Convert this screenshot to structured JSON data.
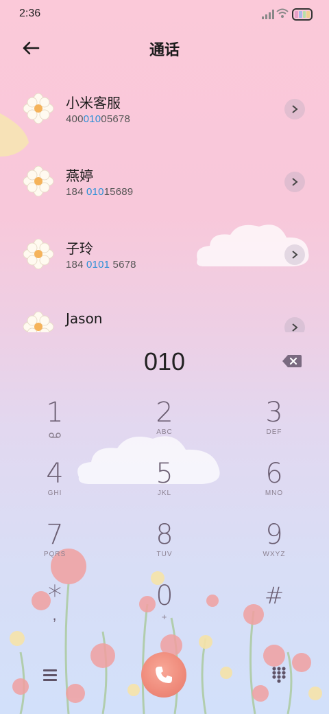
{
  "status": {
    "time": "2:36"
  },
  "header": {
    "title": "通话"
  },
  "contacts": [
    {
      "name": "小米客服",
      "num_pre": "400",
      "num_hl": "010",
      "num_post": "05678"
    },
    {
      "name": "燕婷",
      "num_pre": "184 ",
      "num_hl": "010",
      "num_post": "15689"
    },
    {
      "name": "子玲",
      "num_pre": "184 ",
      "num_hl": "0101",
      "num_post": " 5678"
    },
    {
      "name": "Jason",
      "num_pre": "",
      "num_hl": "",
      "num_post": ""
    }
  ],
  "dialer": {
    "input": "010",
    "keys": [
      {
        "digit": "1",
        "letters": ""
      },
      {
        "digit": "2",
        "letters": "ABC"
      },
      {
        "digit": "3",
        "letters": "DEF"
      },
      {
        "digit": "4",
        "letters": "GHI"
      },
      {
        "digit": "5",
        "letters": "JKL"
      },
      {
        "digit": "6",
        "letters": "MNO"
      },
      {
        "digit": "7",
        "letters": "PQRS"
      },
      {
        "digit": "8",
        "letters": "TUV"
      },
      {
        "digit": "9",
        "letters": "WXYZ"
      },
      {
        "digit": "*",
        "letters": ","
      },
      {
        "digit": "0",
        "letters": "+"
      },
      {
        "digit": "#",
        "letters": ""
      }
    ]
  },
  "colors": {
    "highlight": "#2b8fd6",
    "call_button": "#ef8a7a",
    "key_text": "#6b5e72"
  },
  "icons": {
    "back": "arrow-left-icon",
    "detail": "chevron-right-icon",
    "backspace": "backspace-icon",
    "menu": "menu-icon",
    "call": "phone-icon",
    "keypad": "keypad-icon",
    "voicemail": "voicemail-icon"
  }
}
